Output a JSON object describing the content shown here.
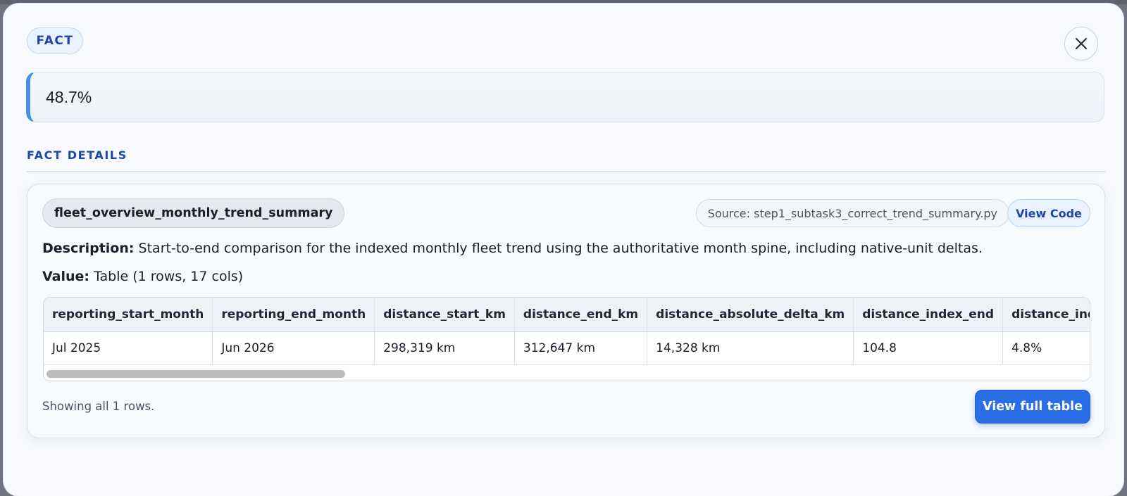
{
  "badge": "FACT",
  "fact_value": "48.7%",
  "section_title": "FACT DETAILS",
  "fact": {
    "name": "fleet_overview_monthly_trend_summary",
    "source": "Source: step1_subtask3_correct_trend_summary.py",
    "view_code_label": "View Code",
    "description_label": "Description:",
    "description": "Start-to-end comparison for the indexed monthly fleet trend using the authoritative month spine, including native-unit deltas.",
    "value_label": "Value:",
    "value": "Table (1 rows, 17 cols)"
  },
  "table": {
    "columns": [
      "reporting_start_month",
      "reporting_end_month",
      "distance_start_km",
      "distance_end_km",
      "distance_absolute_delta_km",
      "distance_index_end",
      "distance_inde"
    ],
    "row": [
      "Jul 2025",
      "Jun 2026",
      "298,319 km",
      "312,647 km",
      "14,328 km",
      "104.8",
      "4.8%"
    ]
  },
  "rows_note": "Showing all 1 rows.",
  "full_table_label": "View full table"
}
